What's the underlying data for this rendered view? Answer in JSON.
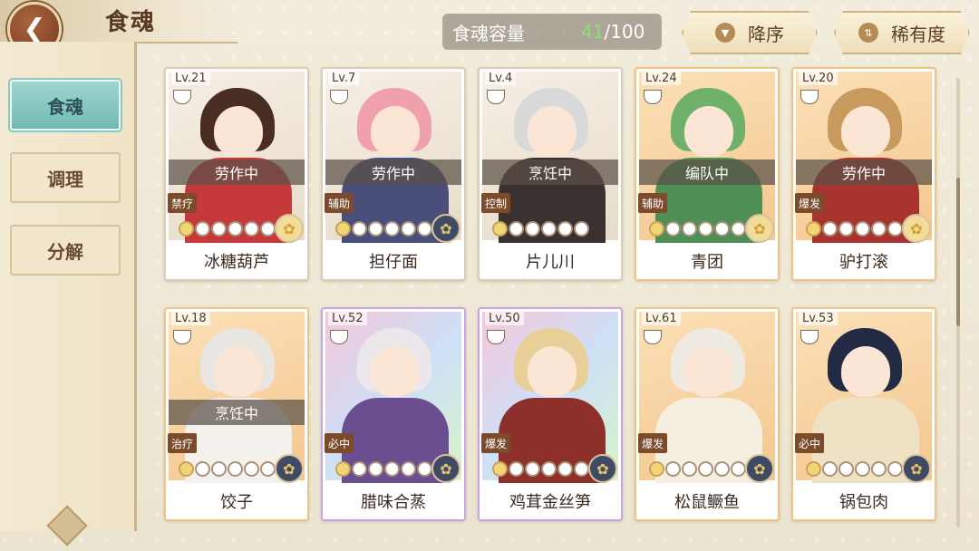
{
  "header": {
    "title": "食魂",
    "back_icon": "back-arrow-icon",
    "capacity": {
      "label": "食魂容量",
      "current": "41",
      "max": "/100"
    },
    "sort_button": {
      "label": "降序",
      "icon": "sort-down-icon"
    },
    "filter_button": {
      "label": "稀有度",
      "icon": "swap-icon"
    }
  },
  "sidebar": {
    "items": [
      {
        "label": "食魂",
        "active": true
      },
      {
        "label": "调理",
        "active": false
      },
      {
        "label": "分解",
        "active": false
      }
    ]
  },
  "cards": [
    {
      "level": "Lv.21",
      "status": "劳作中",
      "role": "禁疗",
      "stars": 5,
      "element": "gold",
      "name": "冰糖葫芦",
      "rarity": "normal",
      "hair": "#4a2d22",
      "body": "#c6393b"
    },
    {
      "level": "Lv.7",
      "status": "劳作中",
      "role": "辅助",
      "stars": 5,
      "element": "navy",
      "name": "担仔面",
      "rarity": "normal",
      "hair": "#f1a0ad",
      "body": "#4a4f7a"
    },
    {
      "level": "Lv.4",
      "status": "烹饪中",
      "role": "控制",
      "stars": 5,
      "element": "none",
      "name": "片儿川",
      "rarity": "normal",
      "hair": "#d9d9d9",
      "body": "#3b3131"
    },
    {
      "level": "Lv.24",
      "status": "编队中",
      "role": "辅助",
      "stars": 5,
      "element": "gold",
      "name": "青团",
      "rarity": "orange",
      "hair": "#6fb06a",
      "body": "#4f8f55"
    },
    {
      "level": "Lv.20",
      "status": "劳作中",
      "role": "爆发",
      "stars": 5,
      "element": "gold",
      "name": "驴打滚",
      "rarity": "orange",
      "hair": "#c99a5e",
      "body": "#a8342f"
    },
    {
      "level": "Lv.18",
      "status": "烹饪中",
      "role": "治疗",
      "stars": 5,
      "element": "navy",
      "name": "饺子",
      "rarity": "orange",
      "hair": "#e9e6e1",
      "body": "#f4f1ec"
    },
    {
      "level": "Lv.52",
      "status": "",
      "role": "必中",
      "stars": 5,
      "element": "navy",
      "name": "腊味合蒸",
      "rarity": "rainbow",
      "hair": "#ece7ea",
      "body": "#6b4e8f"
    },
    {
      "level": "Lv.50",
      "status": "",
      "role": "爆发",
      "stars": 5,
      "element": "navy",
      "name": "鸡茸金丝笋",
      "rarity": "rainbow",
      "hair": "#e8cf98",
      "body": "#8d2f2b"
    },
    {
      "level": "Lv.61",
      "status": "",
      "role": "爆发",
      "stars": 5,
      "element": "navy",
      "name": "松鼠鳜鱼",
      "rarity": "orange",
      "hair": "#f0ebe2",
      "body": "#f5efe2"
    },
    {
      "level": "Lv.53",
      "status": "",
      "role": "必中",
      "stars": 5,
      "element": "navy",
      "name": "锅包肉",
      "rarity": "orange",
      "hair": "#232a44",
      "body": "#efe1c3"
    }
  ],
  "colors": {
    "accent": "#72b9b3",
    "brown": "#5a3a25",
    "capacity_current": "#8be07a"
  }
}
